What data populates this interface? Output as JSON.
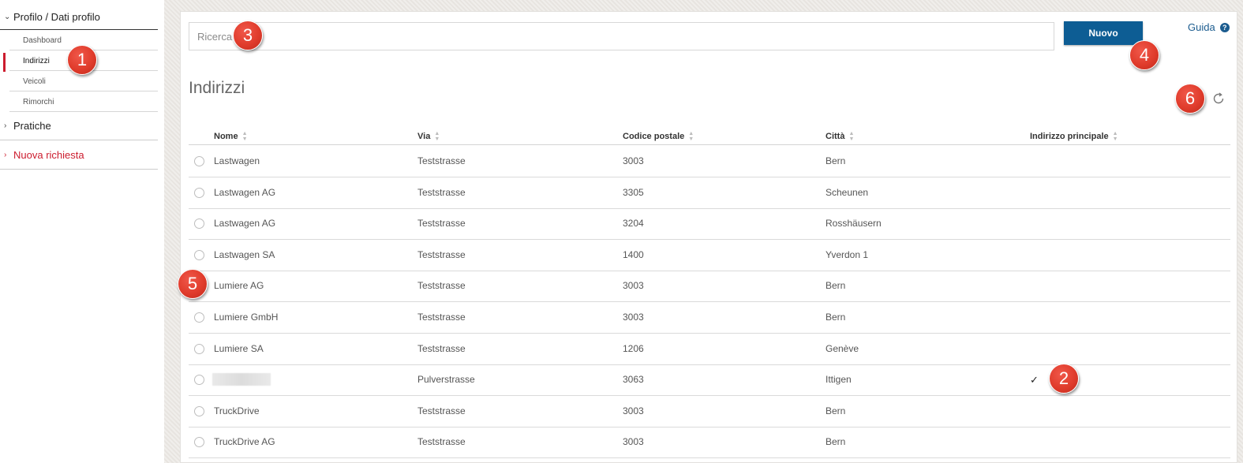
{
  "sidebar": {
    "profile_section": "Profilo / Dati profilo",
    "sub_items": [
      {
        "label": "Dashboard"
      },
      {
        "label": "Indirizzi"
      },
      {
        "label": "Veicoli"
      },
      {
        "label": "Rimorchi"
      }
    ],
    "pratiche": "Pratiche",
    "nuova_richiesta": "Nuova richiesta"
  },
  "search": {
    "placeholder": "Ricerca"
  },
  "toolbar": {
    "new_label": "Nuovo",
    "help_label": "Guida"
  },
  "page": {
    "title": "Indirizzi"
  },
  "table": {
    "headers": [
      "Nome",
      "Via",
      "Codice postale",
      "Città",
      "Indirizzo principale"
    ],
    "rows": [
      {
        "nome": "Lastwagen",
        "via": "Teststrasse",
        "cap": "3003",
        "citta": "Bern",
        "principale": ""
      },
      {
        "nome": "Lastwagen AG",
        "via": "Teststrasse",
        "cap": "3305",
        "citta": "Scheunen",
        "principale": ""
      },
      {
        "nome": "Lastwagen AG",
        "via": "Teststrasse",
        "cap": "3204",
        "citta": "Rosshäusern",
        "principale": ""
      },
      {
        "nome": "Lastwagen SA",
        "via": "Teststrasse",
        "cap": "1400",
        "citta": "Yverdon 1",
        "principale": ""
      },
      {
        "nome": "Lumiere AG",
        "via": "Teststrasse",
        "cap": "3003",
        "citta": "Bern",
        "principale": ""
      },
      {
        "nome": "Lumiere GmbH",
        "via": "Teststrasse",
        "cap": "3003",
        "citta": "Bern",
        "principale": ""
      },
      {
        "nome": "Lumiere SA",
        "via": "Teststrasse",
        "cap": "1206",
        "citta": "Genève",
        "principale": ""
      },
      {
        "nome": "",
        "via": "Pulverstrasse",
        "cap": "3063",
        "citta": "Ittigen",
        "principale": "✓"
      },
      {
        "nome": "TruckDrive",
        "via": "Teststrasse",
        "cap": "3003",
        "citta": "Bern",
        "principale": ""
      },
      {
        "nome": "TruckDrive AG",
        "via": "Teststrasse",
        "cap": "3003",
        "citta": "Bern",
        "principale": ""
      }
    ]
  },
  "markers": [
    "1",
    "2",
    "3",
    "4",
    "5",
    "6"
  ],
  "colors": {
    "accent_red": "#cc1c2e",
    "primary_blue": "#0d5d94",
    "link_blue": "#1b5c8f",
    "marker_red": "#e03c2c"
  },
  "icons": {
    "refresh": "refresh-icon",
    "help": "help-icon",
    "chevron": "chevron-icon"
  }
}
